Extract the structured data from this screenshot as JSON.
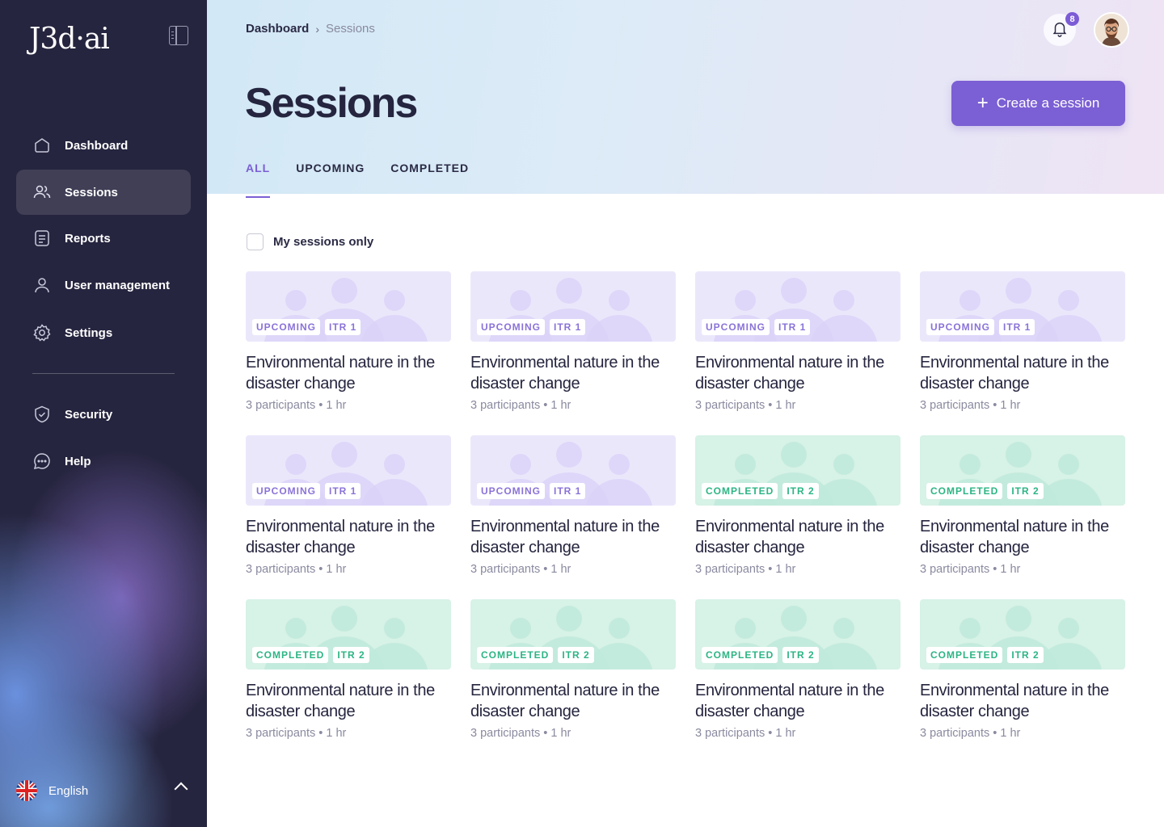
{
  "app": {
    "logo": "J3d·ai"
  },
  "sidebar": {
    "items": [
      {
        "label": "Dashboard",
        "icon": "home-icon"
      },
      {
        "label": "Sessions",
        "icon": "users-icon",
        "active": true
      },
      {
        "label": "Reports",
        "icon": "report-icon"
      },
      {
        "label": "User management",
        "icon": "user-icon"
      },
      {
        "label": "Settings",
        "icon": "gear-icon"
      }
    ],
    "secondary": [
      {
        "label": "Security",
        "icon": "shield-icon"
      },
      {
        "label": "Help",
        "icon": "chat-bubble-icon"
      }
    ],
    "language": {
      "label": "English",
      "flag": "uk-flag-icon"
    }
  },
  "header": {
    "breadcrumb": {
      "parent": "Dashboard",
      "separator": "›",
      "current": "Sessions"
    },
    "notifications": {
      "count": "8"
    },
    "title": "Sessions",
    "create_button": {
      "icon": "+",
      "label": "Create a session"
    },
    "tabs": [
      {
        "label": "ALL",
        "active": true
      },
      {
        "label": "UPCOMING"
      },
      {
        "label": "COMPLETED"
      }
    ]
  },
  "filter": {
    "label": "My sessions only",
    "checked": false
  },
  "colors": {
    "accent": "#7b5fd4",
    "upcoming_bg": "#ebe7fb",
    "completed_bg": "#d7f2e7",
    "completed_text": "#2cb584"
  },
  "sessions": [
    {
      "status": "UPCOMING",
      "iteration": "ITR 1",
      "title": "Environmental nature in the disaster change",
      "participants": "3 participants",
      "duration": "1 hr"
    },
    {
      "status": "UPCOMING",
      "iteration": "ITR 1",
      "title": "Environmental nature in the disaster change",
      "participants": "3 participants",
      "duration": "1 hr"
    },
    {
      "status": "UPCOMING",
      "iteration": "ITR 1",
      "title": "Environmental nature in the disaster change",
      "participants": "3 participants",
      "duration": "1 hr"
    },
    {
      "status": "UPCOMING",
      "iteration": "ITR 1",
      "title": "Environmental nature in the disaster change",
      "participants": "3 participants",
      "duration": "1 hr"
    },
    {
      "status": "UPCOMING",
      "iteration": "ITR 1",
      "title": "Environmental nature in the disaster change",
      "participants": "3 participants",
      "duration": "1 hr"
    },
    {
      "status": "UPCOMING",
      "iteration": "ITR 1",
      "title": "Environmental nature in the disaster change",
      "participants": "3 participants",
      "duration": "1 hr"
    },
    {
      "status": "COMPLETED",
      "iteration": "ITR 2",
      "title": "Environmental nature in the disaster change",
      "participants": "3 participants",
      "duration": "1 hr"
    },
    {
      "status": "COMPLETED",
      "iteration": "ITR 2",
      "title": "Environmental nature in the disaster change",
      "participants": "3 participants",
      "duration": "1 hr"
    },
    {
      "status": "COMPLETED",
      "iteration": "ITR 2",
      "title": "Environmental nature in the disaster change",
      "participants": "3 participants",
      "duration": "1 hr"
    },
    {
      "status": "COMPLETED",
      "iteration": "ITR 2",
      "title": "Environmental nature in the disaster change",
      "participants": "3 participants",
      "duration": "1 hr"
    },
    {
      "status": "COMPLETED",
      "iteration": "ITR 2",
      "title": "Environmental nature in the disaster change",
      "participants": "3 participants",
      "duration": "1 hr"
    },
    {
      "status": "COMPLETED",
      "iteration": "ITR 2",
      "title": "Environmental nature in the disaster change",
      "participants": "3 participants",
      "duration": "1 hr"
    }
  ]
}
